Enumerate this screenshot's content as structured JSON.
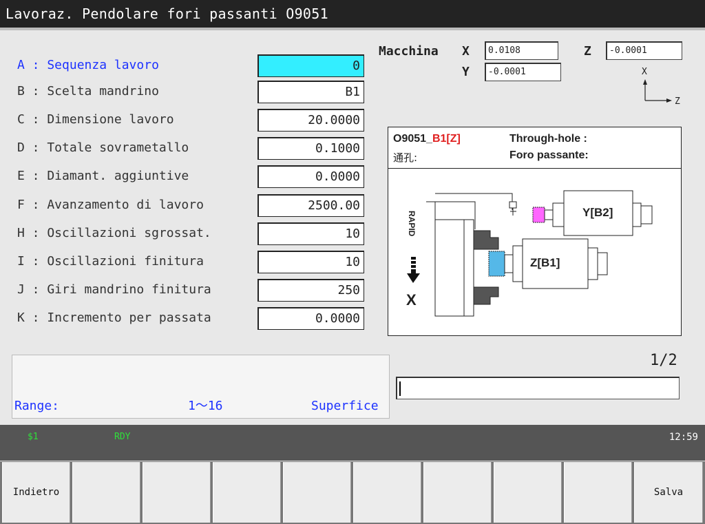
{
  "window": {
    "title": "Lavoraz. Pendolare fori passanti O9051"
  },
  "params": [
    {
      "label": "A : Sequenza lavoro",
      "value": "0"
    },
    {
      "label": "B : Scelta mandrino",
      "value": "B1"
    },
    {
      "label": "C : Dimensione lavoro",
      "value": "20.0000"
    },
    {
      "label": "D : Totale sovrametallo",
      "value": "0.1000"
    },
    {
      "label": "E : Diamant. aggiuntive",
      "value": "0.0000"
    },
    {
      "label": "F : Avanzamento di lavoro",
      "value": "2500.00"
    },
    {
      "label": "H : Oscillazioni sgrossat.",
      "value": "10"
    },
    {
      "label": "I : Oscillazioni finitura",
      "value": "10"
    },
    {
      "label": "J : Giri mandrino finitura",
      "value": "250"
    },
    {
      "label": "K : Incremento per passata",
      "value": "0.0000"
    }
  ],
  "machine": {
    "label": "Macchina",
    "x_label": "X",
    "x_value": "0.0108",
    "y_label": "Y",
    "y_value": "-0.0001",
    "z_label": "Z",
    "z_value": "-0.0001"
  },
  "axis_icon": {
    "x": "X",
    "z": "Z"
  },
  "diagram": {
    "code": "O9051_",
    "spindle_tag": "B1[Z]",
    "through_hole": "Through-hole :",
    "chinese": "通孔:",
    "foro": "Foro passante:",
    "rapid": "RAPID",
    "x_dir": "X",
    "spindle_y": "Y[B2]",
    "spindle_z": "Z[B1]"
  },
  "guide": {
    "range_label": "Range:",
    "range_value": "1～16",
    "surface": "Superfice"
  },
  "page_indicator": "1/2",
  "status": {
    "channel": "$1",
    "state": "RDY",
    "clock": "12:59"
  },
  "softkeys": [
    "Indietro",
    "",
    "",
    "",
    "",
    "",
    "",
    "",
    "",
    "Salva"
  ],
  "colors": {
    "active_field": "#33eeff",
    "active_label": "#1d32ff",
    "status_green": "#2fe13a",
    "tag_red": "#e02020"
  }
}
